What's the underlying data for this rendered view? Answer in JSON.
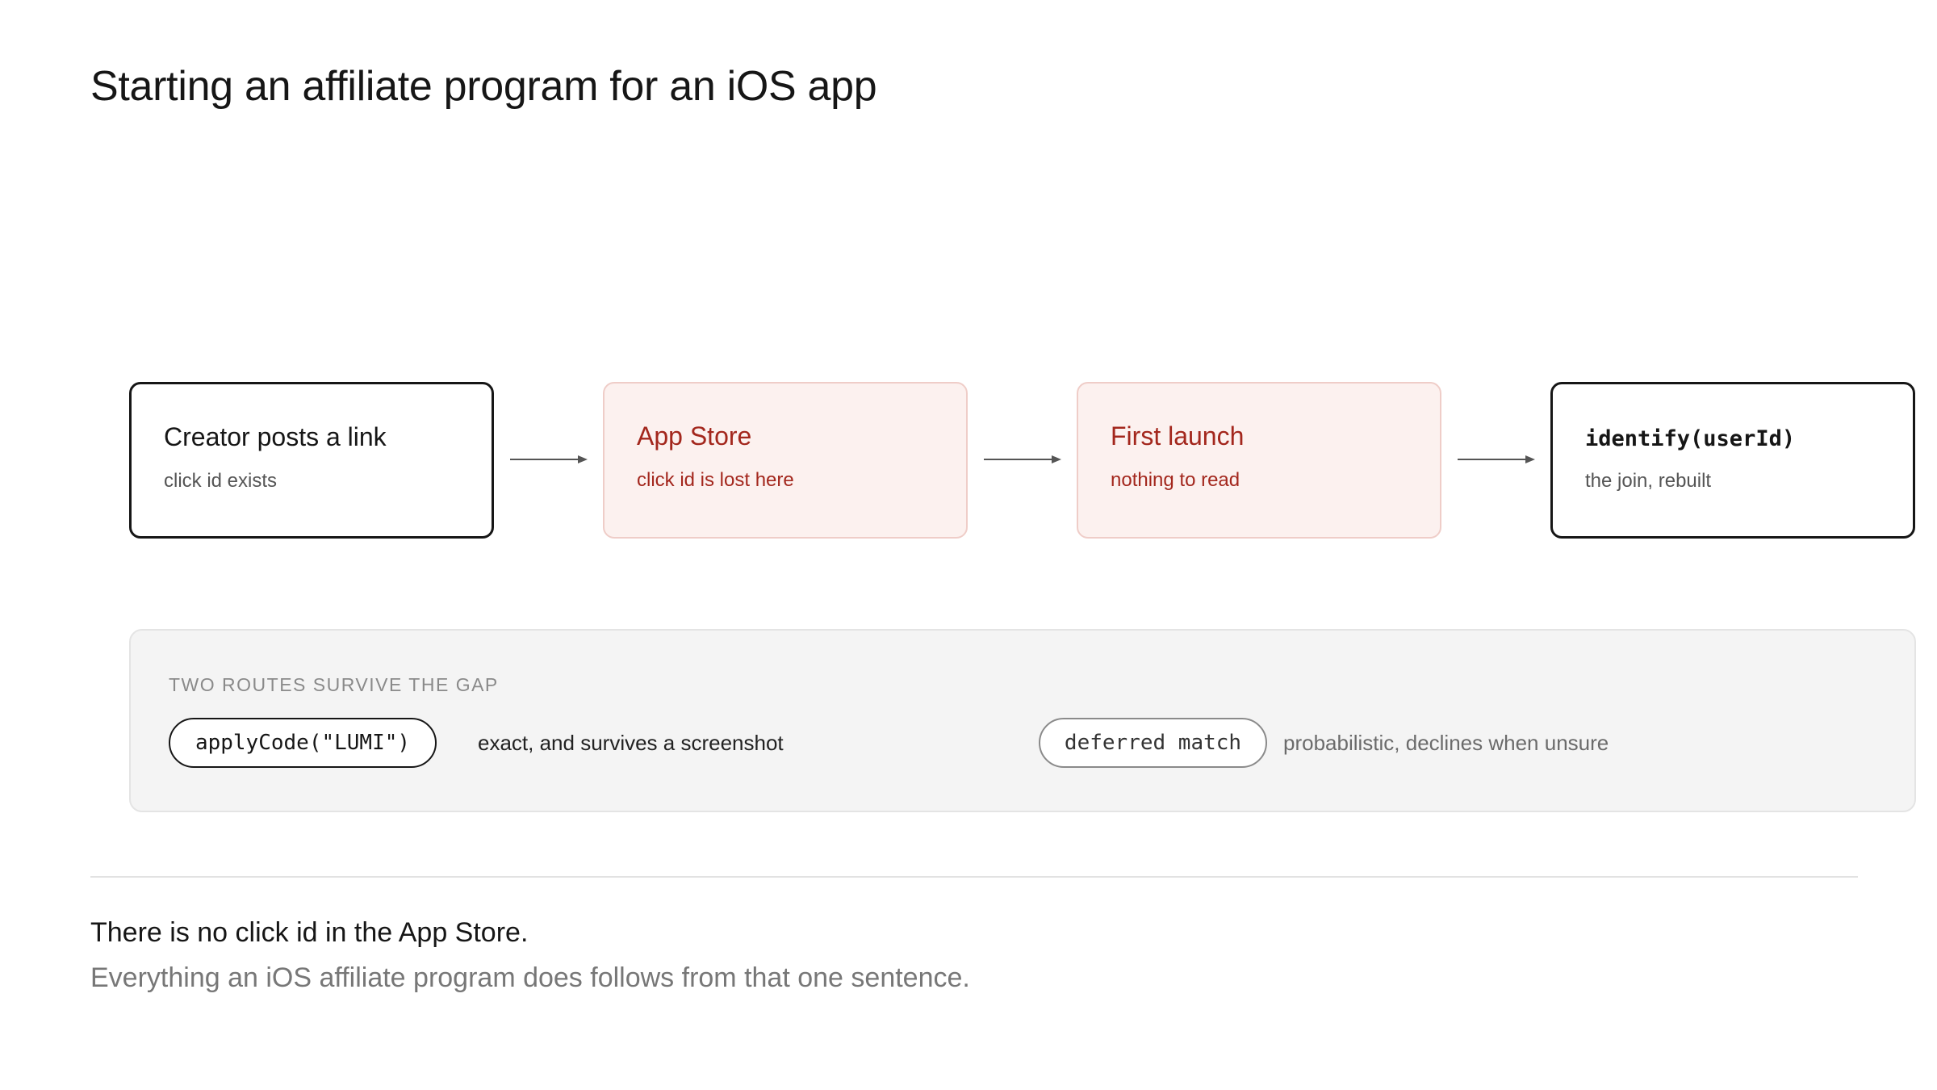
{
  "title": "Starting an affiliate program for an iOS app",
  "flow": [
    {
      "title": "Creator posts a link",
      "subtitle": "click id exists",
      "style": "neutral"
    },
    {
      "title": "App Store",
      "subtitle": "click id is lost here",
      "style": "gap"
    },
    {
      "title": "First launch",
      "subtitle": "nothing to read",
      "style": "gap"
    },
    {
      "title": "identify(userId)",
      "subtitle": "the join, rebuilt",
      "style": "neutral"
    }
  ],
  "routes": {
    "label": "TWO ROUTES SURVIVE THE GAP",
    "items": [
      {
        "code": "applyCode(\"LUMI\")",
        "description": "exact, and survives a screenshot"
      },
      {
        "code": "deferred match",
        "description": "probabilistic, declines when unsure"
      }
    ]
  },
  "footer": {
    "headline": "There is no click id in the App Store.",
    "subline": "Everything an iOS affiliate program does follows from that one sentence."
  },
  "colors": {
    "ink": "#161616",
    "gap_red": "#a3271d",
    "gap_fill": "#fcf1ef",
    "panel_fill": "#f4f4f4"
  }
}
